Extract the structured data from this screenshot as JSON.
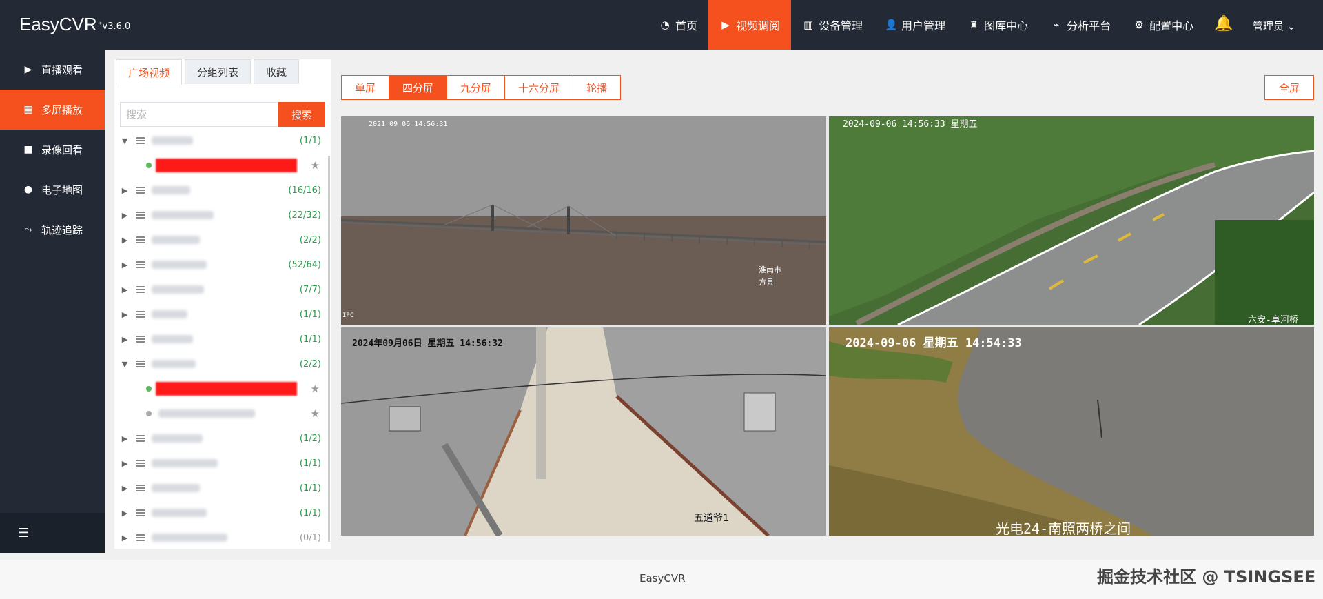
{
  "app": {
    "name": "EasyCVR",
    "version": "v3.6.0"
  },
  "nav": {
    "items": [
      {
        "label": "首页",
        "icon": "dashboard-icon"
      },
      {
        "label": "视频调阅",
        "icon": "play-icon",
        "active": true
      },
      {
        "label": "设备管理",
        "icon": "device-icon"
      },
      {
        "label": "用户管理",
        "icon": "user-icon"
      },
      {
        "label": "图库中心",
        "icon": "gallery-icon"
      },
      {
        "label": "分析平台",
        "icon": "pulse-icon"
      },
      {
        "label": "配置中心",
        "icon": "gear-icon"
      }
    ],
    "user": "管理员"
  },
  "sidebar": {
    "items": [
      {
        "label": "直播观看",
        "icon": "live-icon"
      },
      {
        "label": "多屏播放",
        "icon": "multiscreen-icon",
        "active": true
      },
      {
        "label": "录像回看",
        "icon": "video-record-icon"
      },
      {
        "label": "电子地图",
        "icon": "map-pin-icon"
      },
      {
        "label": "轨迹追踪",
        "icon": "track-icon"
      }
    ]
  },
  "panel": {
    "tabs": [
      "广场视频",
      "分组列表",
      "收藏"
    ],
    "search_placeholder": "搜索",
    "search_button": "搜索",
    "tree": [
      {
        "expanded": true,
        "count": "(1/1)",
        "children": [
          {
            "online": true
          }
        ]
      },
      {
        "expanded": false,
        "count": "(16/16)"
      },
      {
        "expanded": false,
        "count": "(22/32)"
      },
      {
        "expanded": false,
        "count": "(2/2)"
      },
      {
        "expanded": false,
        "count": "(52/64)"
      },
      {
        "expanded": false,
        "count": "(7/7)"
      },
      {
        "expanded": false,
        "count": "(1/1)"
      },
      {
        "expanded": false,
        "count": "(1/1)"
      },
      {
        "expanded": true,
        "count": "(2/2)",
        "children": [
          {
            "online": true
          },
          {
            "online": false
          }
        ]
      },
      {
        "expanded": false,
        "count": "(1/2)"
      },
      {
        "expanded": false,
        "count": "(1/1)"
      },
      {
        "expanded": false,
        "count": "(1/1)"
      },
      {
        "expanded": false,
        "count": "(1/1)"
      },
      {
        "expanded": false,
        "count": "(0/1)",
        "offline": true
      }
    ]
  },
  "layout_buttons": [
    "单屏",
    "四分屏",
    "九分屏",
    "十六分屏",
    "轮播"
  ],
  "active_layout": "四分屏",
  "fullscreen_button": "全屏",
  "video_cells": [
    {
      "timestamp": "2021 09 06 14:56:31",
      "captions": [
        "淮南市",
        "方县",
        "IPC"
      ]
    },
    {
      "timestamp": "2024-09-06 14:56:33 星期五",
      "captions": [
        "六安-阜河桥"
      ]
    },
    {
      "timestamp": "2024年09月06日 星期五 14:56:32",
      "captions": [
        "五道爷1"
      ]
    },
    {
      "timestamp": "2024-09-06 星期五 14:54:33",
      "captions": [
        "光电24-南照两桥之间"
      ]
    }
  ],
  "footer": {
    "text": "EasyCVR"
  },
  "watermark": "掘金技术社区 @ TSINGSEE"
}
